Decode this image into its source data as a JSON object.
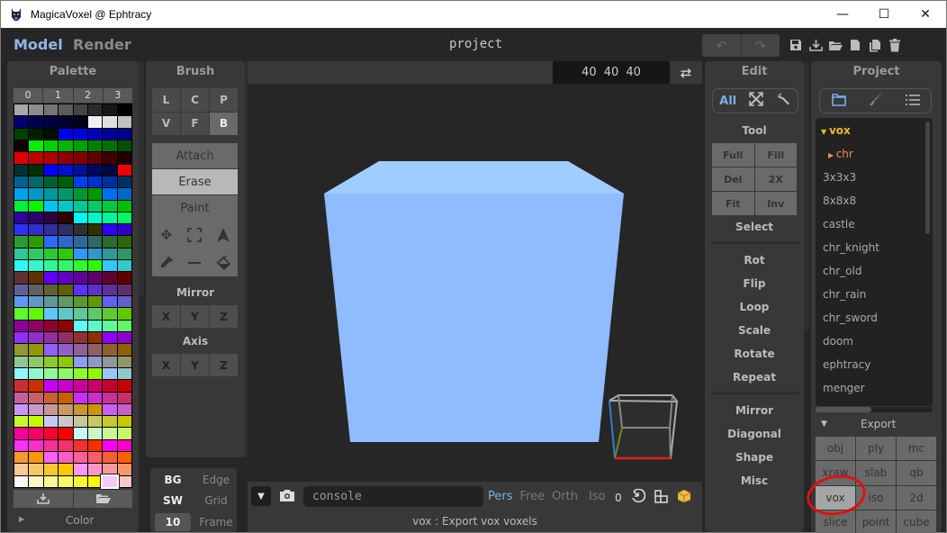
{
  "window": {
    "title": "MagicaVoxel @ Ephtracy",
    "controls": {
      "minimize": "—",
      "maximize": "☐",
      "close": "✕"
    }
  },
  "topbar": {
    "modes": [
      {
        "label": "Model",
        "active": true
      },
      {
        "label": "Render",
        "active": false
      }
    ],
    "project_name": "project",
    "undo_icon": "↶",
    "redo_icon": "↷",
    "file_icons": [
      "save-icon",
      "export-icon",
      "open-folder-icon",
      "new-file-icon",
      "copy-file-icon",
      "trash-icon"
    ]
  },
  "palette": {
    "title": "Palette",
    "tabs": [
      "0",
      "1",
      "2",
      "3"
    ],
    "selected_index": 254,
    "colors": [
      "#a8a8a8",
      "#8c8c8c",
      "#747474",
      "#5c5c5c",
      "#444444",
      "#2c2c2c",
      "#161616",
      "#000000",
      "#000070",
      "#000050",
      "#000040",
      "#000030",
      "#000018",
      "#f0f0f0",
      "#e0e0e0",
      "#c0c0c0",
      "#004000",
      "#002000",
      "#001000",
      "#0000f0",
      "#0000e0",
      "#0000c0",
      "#0000a0",
      "#000090",
      "#100000",
      "#00f000",
      "#00d000",
      "#00b800",
      "#00a000",
      "#008000",
      "#007000",
      "#005000",
      "#e00000",
      "#c00000",
      "#b00000",
      "#900000",
      "#800000",
      "#600000",
      "#400000",
      "#200000",
      "#003030",
      "#003000",
      "#0000f8",
      "#0010d0",
      "#001090",
      "#000860",
      "#000840",
      "#f00000",
      "#006090",
      "#006868",
      "#006030",
      "#006000",
      "#0040f0",
      "#0030d0",
      "#0030a0",
      "#003060",
      "#00a0f0",
      "#0098c8",
      "#009898",
      "#009868",
      "#009830",
      "#009800",
      "#0070f0",
      "#0068c8",
      "#00f040",
      "#00f800",
      "#00c8f0",
      "#00c8c8",
      "#00c898",
      "#00c868",
      "#00c840",
      "#00c000",
      "#3000a0",
      "#300070",
      "#300040",
      "#300000",
      "#00f8f8",
      "#00f8c8",
      "#00f898",
      "#00f868",
      "#3030f8",
      "#3030c8",
      "#303098",
      "#303068",
      "#303030",
      "#303000",
      "#3000f8",
      "#3000c8",
      "#309830",
      "#309800",
      "#3068f8",
      "#3068c8",
      "#306898",
      "#306868",
      "#306830",
      "#306800",
      "#30c898",
      "#30c868",
      "#30c830",
      "#30c800",
      "#3098f8",
      "#3098c8",
      "#309898",
      "#309868",
      "#30f8f8",
      "#30f8c8",
      "#30f898",
      "#30f868",
      "#30f830",
      "#30f800",
      "#30c8f8",
      "#30c8c8",
      "#603030",
      "#603000",
      "#6000f8",
      "#6000c8",
      "#600098",
      "#600068",
      "#600030",
      "#600000",
      "#606098",
      "#606060",
      "#606030",
      "#606000",
      "#6030f8",
      "#6030c8",
      "#603098",
      "#603068",
      "#6098f8",
      "#6098c8",
      "#609898",
      "#609868",
      "#609830",
      "#609800",
      "#6060f8",
      "#6060c8",
      "#60f830",
      "#60f800",
      "#60c8f8",
      "#60c8c8",
      "#60c898",
      "#60c868",
      "#60c830",
      "#60c800",
      "#900098",
      "#900068",
      "#900030",
      "#900000",
      "#60f8f8",
      "#60f8c8",
      "#60f898",
      "#60f868",
      "#9030f8",
      "#9030c8",
      "#903098",
      "#903068",
      "#903030",
      "#903000",
      "#9000f8",
      "#9000c8",
      "#909830",
      "#909800",
      "#9060f8",
      "#9060c8",
      "#906098",
      "#906068",
      "#906030",
      "#906000",
      "#90c898",
      "#90c868",
      "#90c830",
      "#90c800",
      "#9098f8",
      "#9098c8",
      "#909898",
      "#909868",
      "#90f8f8",
      "#90f8c8",
      "#90f898",
      "#90f868",
      "#90f830",
      "#90f800",
      "#98c8f8",
      "#90c8c8",
      "#c83030",
      "#c83000",
      "#c800f8",
      "#c800c8",
      "#c80098",
      "#c80068",
      "#c80030",
      "#c80000",
      "#c86098",
      "#c86068",
      "#c86030",
      "#c86000",
      "#c830f8",
      "#c830c8",
      "#c83098",
      "#c83068",
      "#c898f8",
      "#c898c8",
      "#c89898",
      "#c89868",
      "#c89830",
      "#c89800",
      "#c860f8",
      "#c860c8",
      "#c8f830",
      "#c8f800",
      "#c8c8f8",
      "#c8c8c8",
      "#c8c898",
      "#c8c868",
      "#c8c830",
      "#c8c800",
      "#f80098",
      "#f80068",
      "#f80030",
      "#f80000",
      "#c8f8f8",
      "#c8f8c8",
      "#c8f898",
      "#c8f868",
      "#f830f8",
      "#f830c8",
      "#f83098",
      "#f83068",
      "#f83030",
      "#f83000",
      "#f800f8",
      "#f800c8",
      "#f89830",
      "#f89800",
      "#f860f8",
      "#f860c8",
      "#f86098",
      "#f86068",
      "#f86030",
      "#f86000",
      "#f8c898",
      "#f8c868",
      "#f8c830",
      "#f8c800",
      "#f898f8",
      "#f898c8",
      "#f89898",
      "#f89868",
      "#f8f8f8",
      "#f8f8c8",
      "#f8f898",
      "#f8f868",
      "#f8f830",
      "#f8f800",
      "#f8c8f8",
      "#f8c8c8"
    ],
    "color_section": "Color"
  },
  "brush": {
    "title": "Brush",
    "types": [
      {
        "label": "L",
        "active": false
      },
      {
        "label": "C",
        "active": false
      },
      {
        "label": "P",
        "active": false
      },
      {
        "label": "V",
        "active": false
      },
      {
        "label": "F",
        "active": false
      },
      {
        "label": "B",
        "active": true
      }
    ],
    "modes": [
      {
        "label": "Attach",
        "active": false
      },
      {
        "label": "Erase",
        "active": true
      },
      {
        "label": "Paint",
        "active": false
      }
    ],
    "tool_icons": [
      "move-icon",
      "select-region-icon",
      "cursor-icon",
      "eyedropper-icon",
      "line-icon",
      "fill-bucket-icon"
    ],
    "mirror_label": "Mirror",
    "mirror": [
      "X",
      "Y",
      "Z"
    ],
    "axis_label": "Axis",
    "axis": [
      "X",
      "Y",
      "Z"
    ]
  },
  "display": {
    "bg": "BG",
    "edge": "Edge",
    "sw": "SW",
    "grid": "Grid",
    "frame_value": "10",
    "frame": "Frame"
  },
  "viewport": {
    "dims": "40 40 40",
    "model_color": "#9ac6ff",
    "console_placeholder": "console",
    "view_modes": [
      {
        "label": "Pers",
        "active": true
      },
      {
        "label": "Free",
        "active": false
      },
      {
        "label": "Orth",
        "active": false
      },
      {
        "label": "Iso",
        "active": false
      }
    ],
    "counter": "0",
    "status": "vox : Export vox voxels"
  },
  "edit": {
    "title": "Edit",
    "tabs": [
      "All",
      "transform-icon",
      "wrench-icon"
    ],
    "tool_label": "Tool",
    "tools": [
      "Full",
      "Fill",
      "Del",
      "2X",
      "Fit",
      "Inv"
    ],
    "select_label": "Select",
    "transforms": [
      "Rot",
      "Flip",
      "Loop",
      "Scale",
      "Rotate",
      "Repeat"
    ],
    "generators": [
      "Mirror",
      "Diagonal",
      "Shape",
      "Misc"
    ]
  },
  "project": {
    "title": "Project",
    "tabs": [
      "folder-icon",
      "brush-icon",
      "list-icon"
    ],
    "tree": [
      {
        "label": "vox",
        "type": "folder-open"
      },
      {
        "label": "chr",
        "type": "folder-closed"
      },
      {
        "label": "3x3x3"
      },
      {
        "label": "8x8x8"
      },
      {
        "label": "castle"
      },
      {
        "label": "chr_knight"
      },
      {
        "label": "chr_old"
      },
      {
        "label": "chr_rain"
      },
      {
        "label": "chr_sword"
      },
      {
        "label": "doom"
      },
      {
        "label": "ephtracy"
      },
      {
        "label": "menger"
      }
    ],
    "export_label": "Export",
    "export_formats": [
      "obj",
      "ply",
      "mc",
      "xraw",
      "slab",
      "qb",
      "vox",
      "iso",
      "2d",
      "slice",
      "point",
      "cube"
    ],
    "export_selected": "vox"
  }
}
